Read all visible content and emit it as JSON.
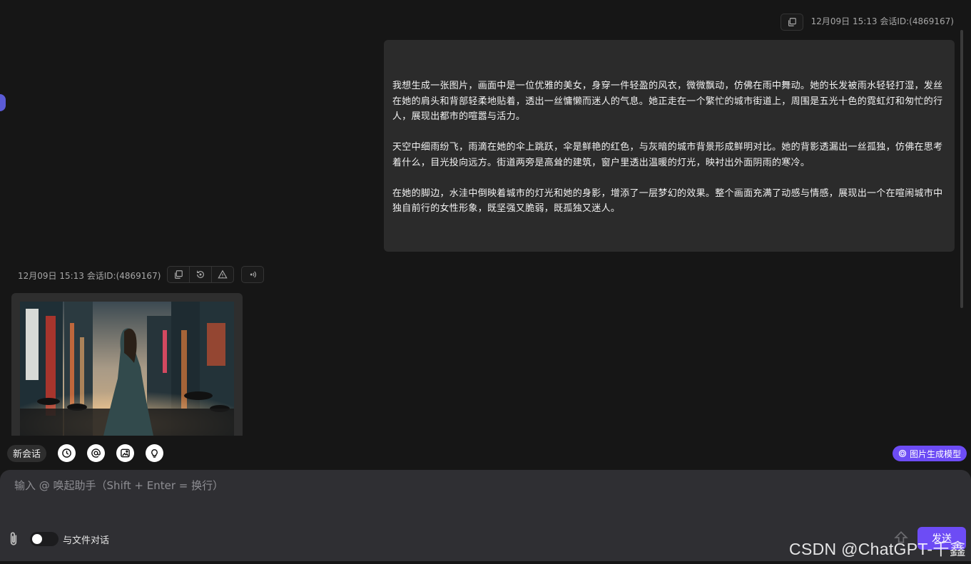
{
  "conversation": {
    "user_message": {
      "meta": "12月09日 15:13 会话ID:(4869167)",
      "paragraphs": [
        "我想生成一张图片，画面中是一位优雅的美女，身穿一件轻盈的风衣，微微飘动，仿佛在雨中舞动。她的长发被雨水轻轻打湿，发丝在她的肩头和背部轻柔地贴着，透出一丝慵懒而迷人的气息。她正走在一个繁忙的城市街道上，周围是五光十色的霓虹灯和匆忙的行人，展现出都市的喧嚣与活力。",
        "天空中细雨纷飞，雨滴在她的伞上跳跃，伞是鲜艳的红色，与灰暗的城市背景形成鲜明对比。她的背影透漏出一丝孤独，仿佛在思考着什么，目光投向远方。街道两旁是高耸的建筑，窗户里透出温暖的灯光，映衬出外面阴雨的寒冷。",
        "在她的脚边，水洼中倒映着城市的灯光和她的身影，增添了一层梦幻的效果。整个画面充满了动感与情感，展现出一个在喧闹城市中独自前行的女性形象，既坚强又脆弱，既孤独又迷人。"
      ]
    },
    "bot_message": {
      "meta": "12月09日 15:13 会话ID:(4869167)"
    }
  },
  "toolbar": {
    "new_chat_label": "新会话",
    "icons": [
      "history-icon",
      "mention-icon",
      "image-icon",
      "lightbulb-icon"
    ],
    "model_label": "图片生成模型"
  },
  "input": {
    "placeholder": "输入 @ 唤起助手（Shift + Enter = 换行）",
    "file_toggle_label": "与文件对话",
    "file_toggle_on": false,
    "send_label": "发送"
  },
  "watermark": "CSDN @ChatGPT-千鑫",
  "colors": {
    "accent": "#6d4cf5",
    "background": "#161616",
    "bubble": "#2b2b2b",
    "input_panel": "#2f2f33"
  }
}
